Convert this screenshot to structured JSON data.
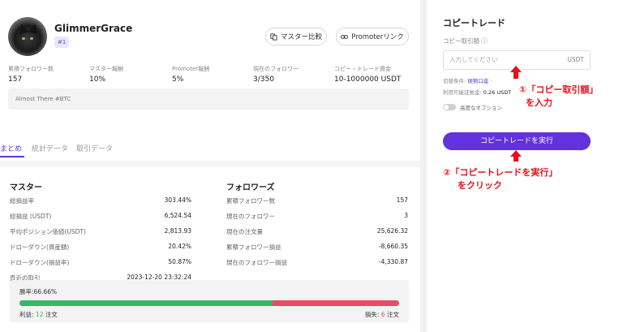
{
  "trader": {
    "name": "GlimmerGrace",
    "rank": "#1",
    "compare_label": "マスター比較",
    "promoter_label": "Promoterリンク",
    "bio": "Almost There #BTC"
  },
  "stats": [
    {
      "label": "累積フォロワー数",
      "value": "157"
    },
    {
      "label": "マスター報酬",
      "value": "10%"
    },
    {
      "label": "Promoter報酬",
      "value": "5%"
    },
    {
      "label": "現在のフォロワー",
      "value": "3/350"
    },
    {
      "label": "コピー・トレード資金",
      "value": "10-1000000 USDT"
    }
  ],
  "tabs": [
    "まとめ",
    "統計データ",
    "取引データ"
  ],
  "master": {
    "title": "マスター",
    "rows": [
      {
        "label": "総損益率",
        "value": "303.44%"
      },
      {
        "label": "総損益 (USDT)",
        "value": "6,524.54"
      },
      {
        "label": "平均ポジション価値(USDT)",
        "value": "2,813.93"
      },
      {
        "label": "ドローダウン(資産額)",
        "value": "20.42%"
      },
      {
        "label": "ドローダウン(損益率)",
        "value": "50.87%"
      },
      {
        "label": "直近の取引",
        "value": "2023-12-20 23:32:24"
      }
    ]
  },
  "followers": {
    "title": "フォロワーズ",
    "rows": [
      {
        "label": "累積フォロワー数",
        "value": "157"
      },
      {
        "label": "現在のフォロワー",
        "value": "3"
      },
      {
        "label": "現在の注文量",
        "value": "25,626.32"
      },
      {
        "label": "累積フォロワー損益",
        "value": "-8,660.35"
      },
      {
        "label": "現在のフォロワー損益",
        "value": "-4,330.87"
      }
    ]
  },
  "winrate": {
    "label": "勝率:66.66%",
    "win_fraction": 0.6666,
    "profit_label": "利益:",
    "profit_count": "12",
    "profit_unit": "注文",
    "loss_label": "損失:",
    "loss_count": "6",
    "loss_unit": "注文"
  },
  "copy": {
    "title": "コピートレード",
    "amount_label": "コピー取引額 ⓘ",
    "placeholder": "入力してください",
    "unit": "USDT",
    "switch_line_prefix": "切替条件:",
    "switch_line_link": "現物口座",
    "switch_line_suffix": " ·",
    "available_label": "利用可能証拠金:",
    "available_value": "0.26 USDT",
    "advanced_label": "高度なオプション",
    "execute_label": "コピートレードを実行"
  },
  "annotations": {
    "note1_line1": "①「コピー取引額」",
    "note1_line2": "を入力",
    "note2_line1": "②「コピートレードを実行」",
    "note2_line2": "をクリック"
  },
  "colors": {
    "accent": "#6232dd",
    "win": "#35b86a",
    "loss": "#e84a6a",
    "annotation": "#e8101a"
  }
}
